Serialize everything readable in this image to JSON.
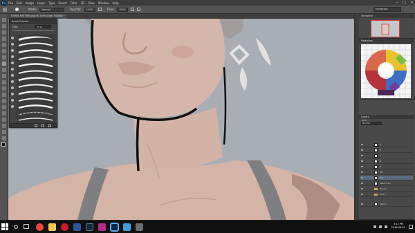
{
  "app": {
    "logo_text": "Ps",
    "menu": [
      "File",
      "Edit",
      "Image",
      "Layer",
      "Type",
      "Select",
      "Filter",
      "3D",
      "View",
      "Window",
      "Help"
    ],
    "window_controls": [
      "–",
      "□",
      "×"
    ]
  },
  "options_bar": {
    "mode_label": "Mode:",
    "mode_value": "Normal",
    "opacity_label": "Opacity:",
    "opacity_value": "100%",
    "flow_label": "Flow:",
    "flow_value": "100%",
    "workspace_value": "Essentials"
  },
  "document": {
    "tab_label": "CHARL RAF REN.psd @ 200% (line, RGB/8) *"
  },
  "brush_panel": {
    "title": "Brush Presets",
    "size_label": "Size:",
    "size_value": "34 px",
    "brush_count": 13
  },
  "right_dock": {
    "navigator_title": "Navigator",
    "swatches_title": "Swatches",
    "layers_title": "Layers",
    "layers_kind": "Kind",
    "layers_mode": "Normal",
    "layers": [
      {
        "name": "5"
      },
      {
        "name": "6"
      },
      {
        "name": "7"
      },
      {
        "name": "8"
      },
      {
        "name": "9"
      },
      {
        "name": "10"
      },
      {
        "name": "line"
      },
      {
        "name": "Shell 1 ++"
      },
      {
        "name": "Tyrone"
      },
      {
        "name": "Ums"
      },
      {
        "name": "Layer 1"
      }
    ]
  },
  "taskbar": {
    "time": "3:11 PM",
    "date": "2018-06-01",
    "apps": [
      {
        "name": "chrome",
        "color": "#e8453c"
      },
      {
        "name": "explorer",
        "color": "#f2c94c"
      },
      {
        "name": "opera",
        "color": "#cc1b2b"
      },
      {
        "name": "word",
        "color": "#2b579a"
      },
      {
        "name": "steam",
        "color": "#1b2838"
      },
      {
        "name": "media",
        "color": "#b52d8c"
      },
      {
        "name": "photoshop",
        "color": "#0c2a4a"
      },
      {
        "name": "paint",
        "color": "#3aa0d8"
      },
      {
        "name": "notes",
        "color": "#6d6d6d"
      }
    ]
  },
  "colors": {
    "canvas_bg": "#a8adb3",
    "skin": "#d6b7a9",
    "line": "#111111",
    "accent": "#4fa7ff"
  }
}
